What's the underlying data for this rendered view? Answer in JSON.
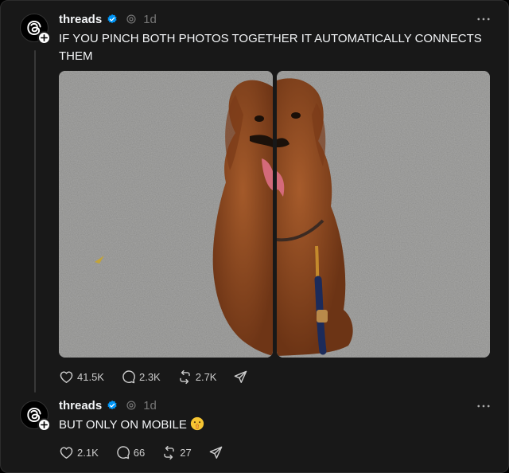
{
  "posts": [
    {
      "username": "threads",
      "time": "1d",
      "text": "IF YOU PINCH BOTH PHOTOS TOGETHER IT AUTOMATICALLY CONNECTS THEM",
      "images": [
        "left-half-dog-photo",
        "right-half-dog-photo"
      ],
      "likes": "41.5K",
      "replies": "2.3K",
      "reposts": "2.7K"
    },
    {
      "username": "threads",
      "time": "1d",
      "text": "BUT ONLY ON MOBILE",
      "emoji": "shushing-face-emoji",
      "likes": "2.1K",
      "replies": "66",
      "reposts": "27"
    }
  ],
  "icons": {
    "avatar": "threads-logo-icon",
    "verified": "verified-badge-icon",
    "more": "more-options-icon",
    "like": "heart-icon",
    "reply": "reply-bubble-icon",
    "repost": "repost-icon",
    "share": "send-icon"
  },
  "colors": {
    "background": "#181818",
    "text": "#f3f5f7",
    "muted": "#777777",
    "verified": "#0095f6"
  }
}
